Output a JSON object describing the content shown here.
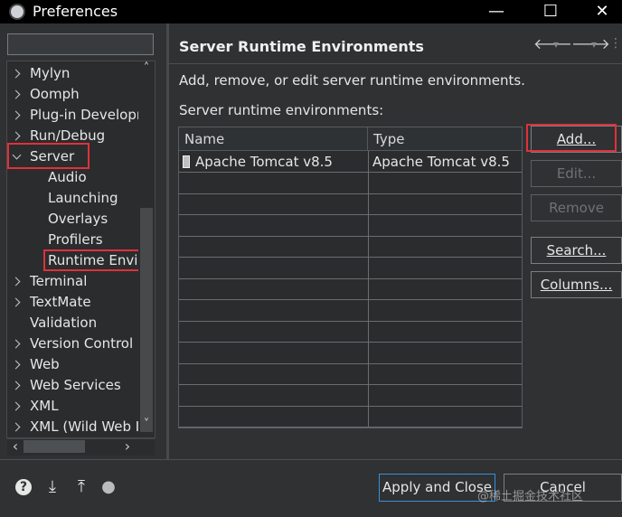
{
  "window": {
    "title": "Preferences",
    "minimize_glyph": "—",
    "maximize_glyph": "☐",
    "close_glyph": "✕"
  },
  "sidebar": {
    "filter_value": "",
    "items": [
      {
        "label": "Mylyn",
        "level": 0,
        "expander": "collapsed"
      },
      {
        "label": "Oomph",
        "level": 0,
        "expander": "collapsed"
      },
      {
        "label": "Plug-in Developr",
        "level": 0,
        "expander": "collapsed"
      },
      {
        "label": "Run/Debug",
        "level": 0,
        "expander": "collapsed"
      },
      {
        "label": "Server",
        "level": 0,
        "expander": "expanded",
        "highlighted": true
      },
      {
        "label": "Audio",
        "level": 1,
        "expander": "none"
      },
      {
        "label": "Launching",
        "level": 1,
        "expander": "none"
      },
      {
        "label": "Overlays",
        "level": 1,
        "expander": "none"
      },
      {
        "label": "Profilers",
        "level": 1,
        "expander": "none"
      },
      {
        "label": "Runtime Envir",
        "level": 1,
        "expander": "none",
        "selected": true,
        "highlighted": true
      },
      {
        "label": "Terminal",
        "level": 0,
        "expander": "collapsed"
      },
      {
        "label": "TextMate",
        "level": 0,
        "expander": "collapsed"
      },
      {
        "label": "Validation",
        "level": 0,
        "expander": "none"
      },
      {
        "label": "Version Control (",
        "level": 0,
        "expander": "collapsed"
      },
      {
        "label": "Web",
        "level": 0,
        "expander": "collapsed"
      },
      {
        "label": "Web Services",
        "level": 0,
        "expander": "collapsed"
      },
      {
        "label": "XML",
        "level": 0,
        "expander": "collapsed"
      },
      {
        "label": "XML (Wild Web I",
        "level": 0,
        "expander": "collapsed"
      }
    ],
    "scroll_up_glyph": "˄",
    "scroll_down_glyph": "˅",
    "scroll_left_glyph": "‹",
    "scroll_right_glyph": "›"
  },
  "page": {
    "title": "Server Runtime Environments",
    "nav_back_glyph": "🡐",
    "nav_forward_glyph": "🡒",
    "nav_dropdown_glyph": "▾",
    "nav_menu_glyph": "⋮",
    "description": "Add, remove, or edit server runtime environments.",
    "table_label": "Server runtime environments:",
    "table": {
      "columns": [
        "Name",
        "Type"
      ],
      "rows": [
        {
          "name": "Apache Tomcat v8.5",
          "type": "Apache Tomcat v8.5"
        }
      ]
    },
    "buttons": {
      "add": "Add...",
      "edit": "Edit...",
      "remove": "Remove",
      "search": "Search...",
      "columns": "Columns..."
    }
  },
  "footer": {
    "help_glyph": "?",
    "import_glyph": "⤓",
    "export_glyph": "⤒",
    "record_glyph": "●",
    "apply_close": "Apply and Close",
    "cancel": "Cancel",
    "watermark": "@稀土掘金技术社区"
  },
  "colors": {
    "background": "#2f3133",
    "highlight_border": "#e0313b",
    "default_button_border": "#3b8fd9"
  }
}
